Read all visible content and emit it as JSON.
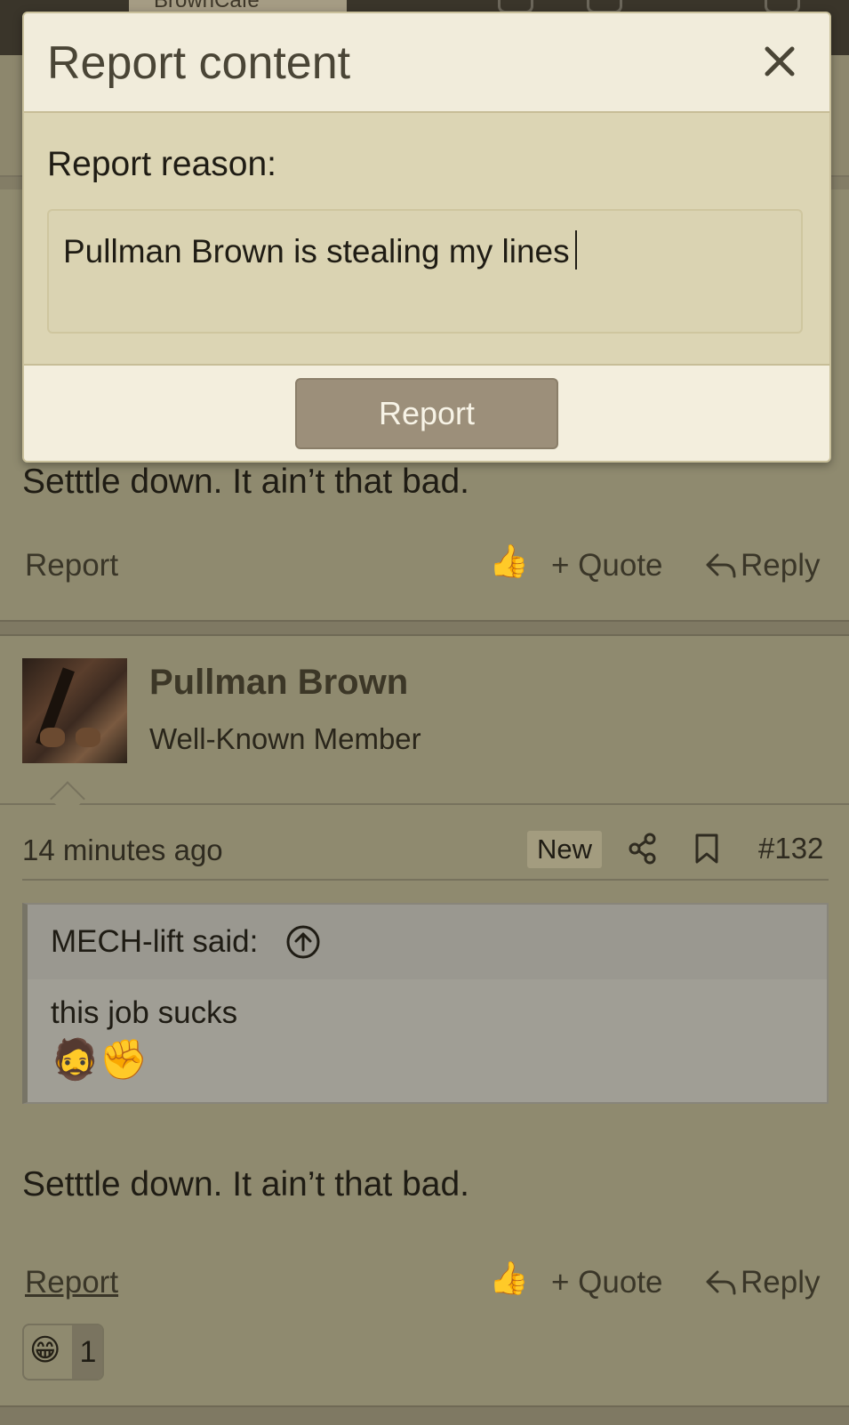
{
  "header": {
    "site_name": "BrownCafe"
  },
  "modal": {
    "title": "Report content",
    "close_icon": "close-icon",
    "reason_label": "Report reason:",
    "reason_value": "Pullman Brown is stealing my lines",
    "submit_label": "Report"
  },
  "previous_post": {
    "text": "Setttle down. It ain’t that bad.",
    "actions": {
      "report": "Report",
      "like_icon": "thumbs-up-icon",
      "quote": "+ Quote",
      "reply": "Reply"
    }
  },
  "post": {
    "author": "Pullman Brown",
    "author_title": "Well-Known Member",
    "time": "14 minutes ago",
    "badge": "New",
    "post_number": "#132",
    "quote": {
      "author_label": "MECH-lift said:",
      "body": "this job sucks",
      "emoji": "🧔✊"
    },
    "text": "Setttle down. It ain’t that bad.",
    "actions": {
      "report": "Report",
      "quote": "+ Quote",
      "reply": "Reply"
    },
    "reaction": {
      "emoji": "😁",
      "count": "1"
    }
  },
  "colors": {
    "page_bg": "#8f8a6f",
    "modal_bg": "#f0ebd9",
    "modal_body_bg": "#dcd5b4",
    "button_bg": "#9c8f7a",
    "topbar": "#3a352a"
  }
}
